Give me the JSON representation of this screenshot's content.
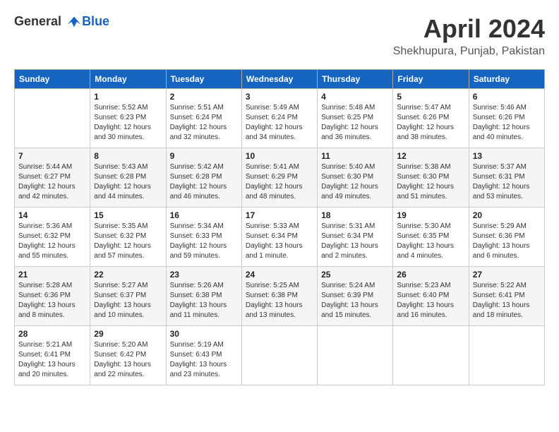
{
  "header": {
    "logo_line1": "General",
    "logo_line2": "Blue",
    "month_title": "April 2024",
    "location": "Shekhupura, Punjab, Pakistan"
  },
  "weekdays": [
    "Sunday",
    "Monday",
    "Tuesday",
    "Wednesday",
    "Thursday",
    "Friday",
    "Saturday"
  ],
  "weeks": [
    [
      {
        "day": "",
        "sunrise": "",
        "sunset": "",
        "daylight": ""
      },
      {
        "day": "1",
        "sunrise": "Sunrise: 5:52 AM",
        "sunset": "Sunset: 6:23 PM",
        "daylight": "Daylight: 12 hours and 30 minutes."
      },
      {
        "day": "2",
        "sunrise": "Sunrise: 5:51 AM",
        "sunset": "Sunset: 6:24 PM",
        "daylight": "Daylight: 12 hours and 32 minutes."
      },
      {
        "day": "3",
        "sunrise": "Sunrise: 5:49 AM",
        "sunset": "Sunset: 6:24 PM",
        "daylight": "Daylight: 12 hours and 34 minutes."
      },
      {
        "day": "4",
        "sunrise": "Sunrise: 5:48 AM",
        "sunset": "Sunset: 6:25 PM",
        "daylight": "Daylight: 12 hours and 36 minutes."
      },
      {
        "day": "5",
        "sunrise": "Sunrise: 5:47 AM",
        "sunset": "Sunset: 6:26 PM",
        "daylight": "Daylight: 12 hours and 38 minutes."
      },
      {
        "day": "6",
        "sunrise": "Sunrise: 5:46 AM",
        "sunset": "Sunset: 6:26 PM",
        "daylight": "Daylight: 12 hours and 40 minutes."
      }
    ],
    [
      {
        "day": "7",
        "sunrise": "Sunrise: 5:44 AM",
        "sunset": "Sunset: 6:27 PM",
        "daylight": "Daylight: 12 hours and 42 minutes."
      },
      {
        "day": "8",
        "sunrise": "Sunrise: 5:43 AM",
        "sunset": "Sunset: 6:28 PM",
        "daylight": "Daylight: 12 hours and 44 minutes."
      },
      {
        "day": "9",
        "sunrise": "Sunrise: 5:42 AM",
        "sunset": "Sunset: 6:28 PM",
        "daylight": "Daylight: 12 hours and 46 minutes."
      },
      {
        "day": "10",
        "sunrise": "Sunrise: 5:41 AM",
        "sunset": "Sunset: 6:29 PM",
        "daylight": "Daylight: 12 hours and 48 minutes."
      },
      {
        "day": "11",
        "sunrise": "Sunrise: 5:40 AM",
        "sunset": "Sunset: 6:30 PM",
        "daylight": "Daylight: 12 hours and 49 minutes."
      },
      {
        "day": "12",
        "sunrise": "Sunrise: 5:38 AM",
        "sunset": "Sunset: 6:30 PM",
        "daylight": "Daylight: 12 hours and 51 minutes."
      },
      {
        "day": "13",
        "sunrise": "Sunrise: 5:37 AM",
        "sunset": "Sunset: 6:31 PM",
        "daylight": "Daylight: 12 hours and 53 minutes."
      }
    ],
    [
      {
        "day": "14",
        "sunrise": "Sunrise: 5:36 AM",
        "sunset": "Sunset: 6:32 PM",
        "daylight": "Daylight: 12 hours and 55 minutes."
      },
      {
        "day": "15",
        "sunrise": "Sunrise: 5:35 AM",
        "sunset": "Sunset: 6:32 PM",
        "daylight": "Daylight: 12 hours and 57 minutes."
      },
      {
        "day": "16",
        "sunrise": "Sunrise: 5:34 AM",
        "sunset": "Sunset: 6:33 PM",
        "daylight": "Daylight: 12 hours and 59 minutes."
      },
      {
        "day": "17",
        "sunrise": "Sunrise: 5:33 AM",
        "sunset": "Sunset: 6:34 PM",
        "daylight": "Daylight: 13 hours and 1 minute."
      },
      {
        "day": "18",
        "sunrise": "Sunrise: 5:31 AM",
        "sunset": "Sunset: 6:34 PM",
        "daylight": "Daylight: 13 hours and 2 minutes."
      },
      {
        "day": "19",
        "sunrise": "Sunrise: 5:30 AM",
        "sunset": "Sunset: 6:35 PM",
        "daylight": "Daylight: 13 hours and 4 minutes."
      },
      {
        "day": "20",
        "sunrise": "Sunrise: 5:29 AM",
        "sunset": "Sunset: 6:36 PM",
        "daylight": "Daylight: 13 hours and 6 minutes."
      }
    ],
    [
      {
        "day": "21",
        "sunrise": "Sunrise: 5:28 AM",
        "sunset": "Sunset: 6:36 PM",
        "daylight": "Daylight: 13 hours and 8 minutes."
      },
      {
        "day": "22",
        "sunrise": "Sunrise: 5:27 AM",
        "sunset": "Sunset: 6:37 PM",
        "daylight": "Daylight: 13 hours and 10 minutes."
      },
      {
        "day": "23",
        "sunrise": "Sunrise: 5:26 AM",
        "sunset": "Sunset: 6:38 PM",
        "daylight": "Daylight: 13 hours and 11 minutes."
      },
      {
        "day": "24",
        "sunrise": "Sunrise: 5:25 AM",
        "sunset": "Sunset: 6:38 PM",
        "daylight": "Daylight: 13 hours and 13 minutes."
      },
      {
        "day": "25",
        "sunrise": "Sunrise: 5:24 AM",
        "sunset": "Sunset: 6:39 PM",
        "daylight": "Daylight: 13 hours and 15 minutes."
      },
      {
        "day": "26",
        "sunrise": "Sunrise: 5:23 AM",
        "sunset": "Sunset: 6:40 PM",
        "daylight": "Daylight: 13 hours and 16 minutes."
      },
      {
        "day": "27",
        "sunrise": "Sunrise: 5:22 AM",
        "sunset": "Sunset: 6:41 PM",
        "daylight": "Daylight: 13 hours and 18 minutes."
      }
    ],
    [
      {
        "day": "28",
        "sunrise": "Sunrise: 5:21 AM",
        "sunset": "Sunset: 6:41 PM",
        "daylight": "Daylight: 13 hours and 20 minutes."
      },
      {
        "day": "29",
        "sunrise": "Sunrise: 5:20 AM",
        "sunset": "Sunset: 6:42 PM",
        "daylight": "Daylight: 13 hours and 22 minutes."
      },
      {
        "day": "30",
        "sunrise": "Sunrise: 5:19 AM",
        "sunset": "Sunset: 6:43 PM",
        "daylight": "Daylight: 13 hours and 23 minutes."
      },
      {
        "day": "",
        "sunrise": "",
        "sunset": "",
        "daylight": ""
      },
      {
        "day": "",
        "sunrise": "",
        "sunset": "",
        "daylight": ""
      },
      {
        "day": "",
        "sunrise": "",
        "sunset": "",
        "daylight": ""
      },
      {
        "day": "",
        "sunrise": "",
        "sunset": "",
        "daylight": ""
      }
    ]
  ]
}
